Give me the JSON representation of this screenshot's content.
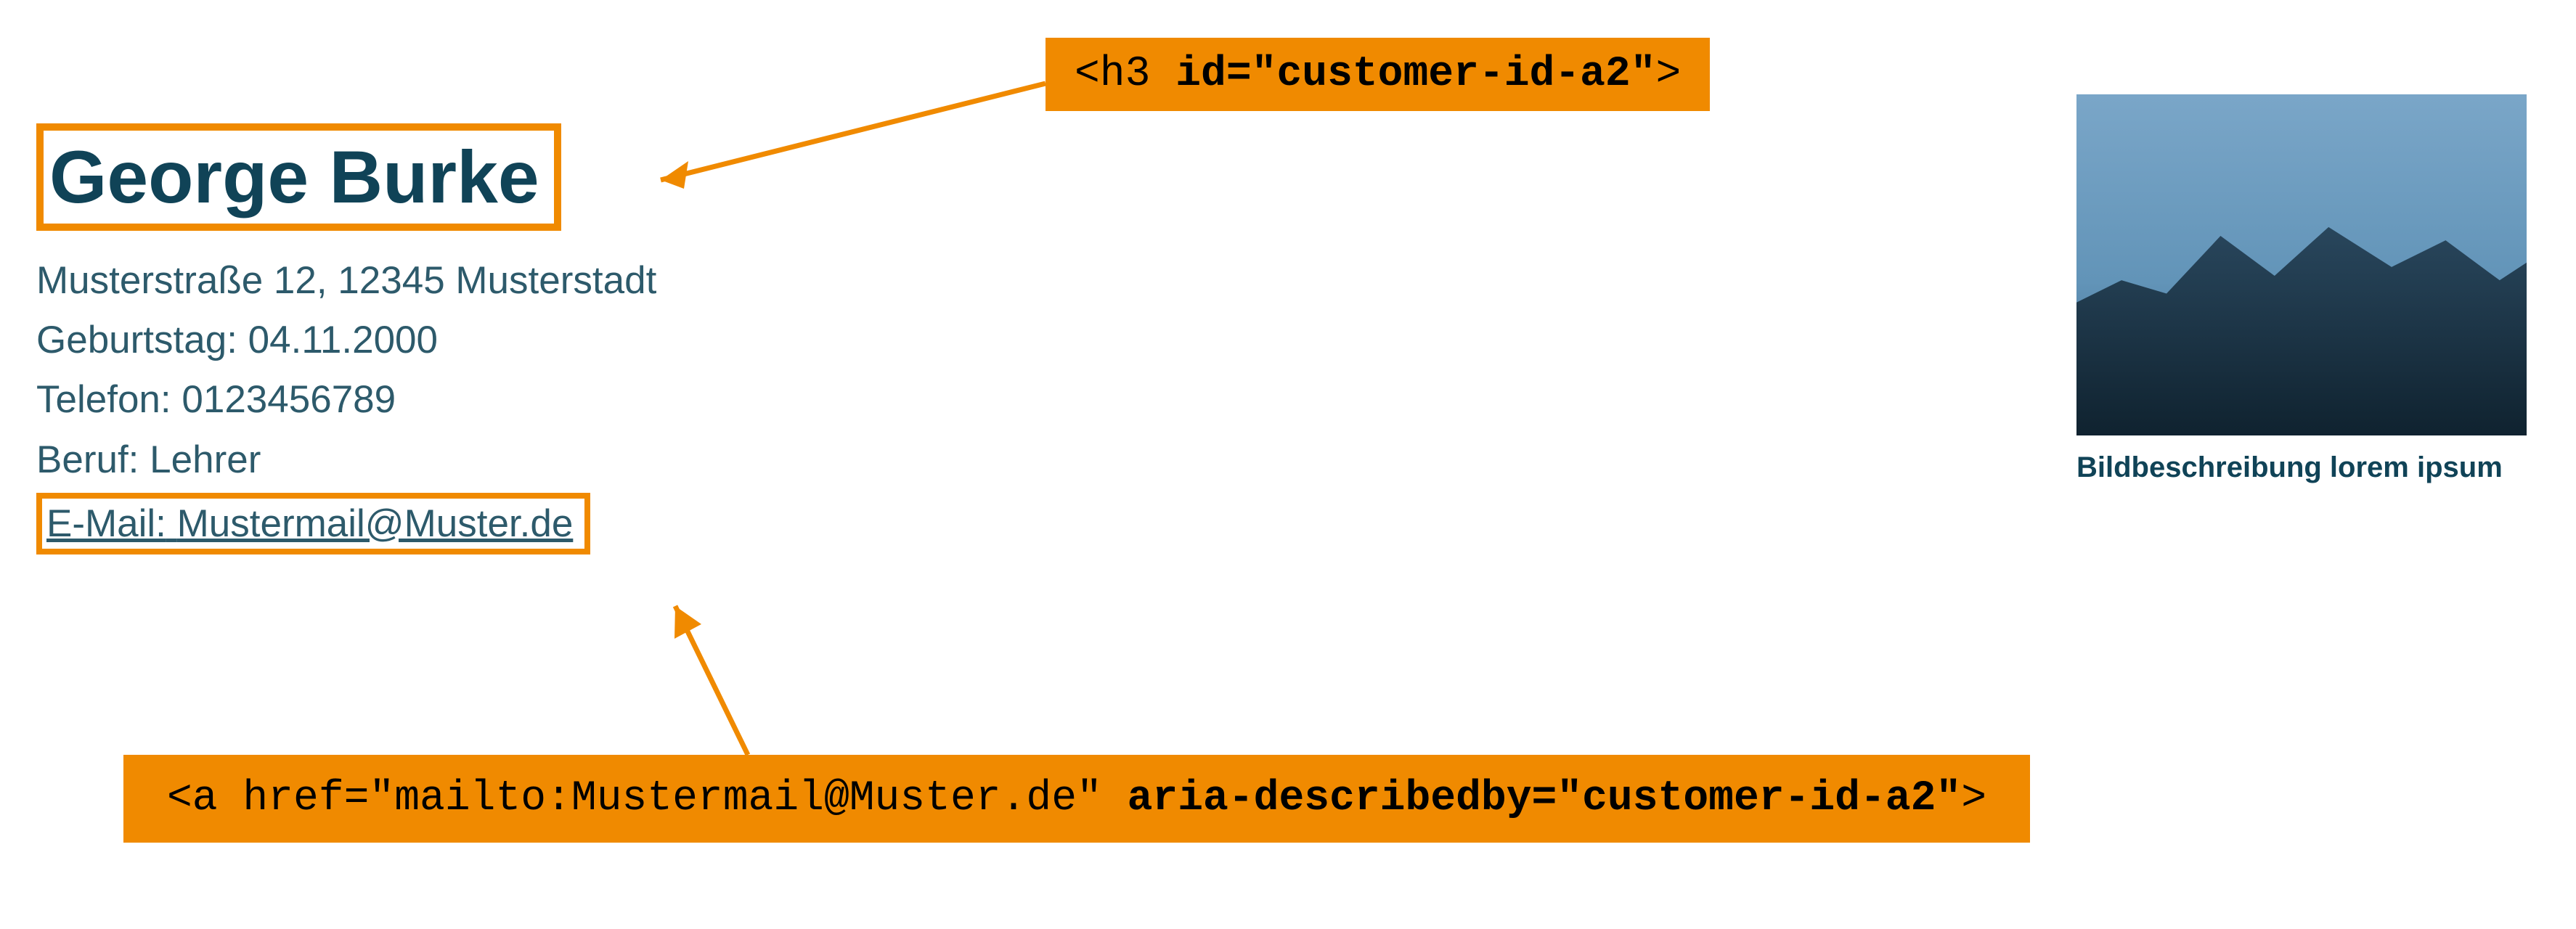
{
  "card": {
    "name": "George Burke",
    "address": "Musterstraße 12, 12345 Musterstadt",
    "birthday_label": "Geburtstag:",
    "birthday_value": "04.11.2000",
    "phone_label": "Telefon:",
    "phone_value": "0123456789",
    "job_label": "Beruf:",
    "job_value": "Lehrer",
    "email_label": "E-Mail:",
    "email_value": "Mustermail@Muster.de"
  },
  "annotation_top": {
    "tag_open": "<h3 ",
    "attr": "id=\"customer-id-a2\"",
    "tag_close": ">"
  },
  "annotation_bottom": {
    "tag_open": "<a href=\"mailto:Mustermail@Muster.de\" ",
    "attr": "aria-describedby=\"customer-id-a2\"",
    "tag_close": ">"
  },
  "image_card": {
    "caption": "Bildbeschreibung lorem ipsum"
  }
}
